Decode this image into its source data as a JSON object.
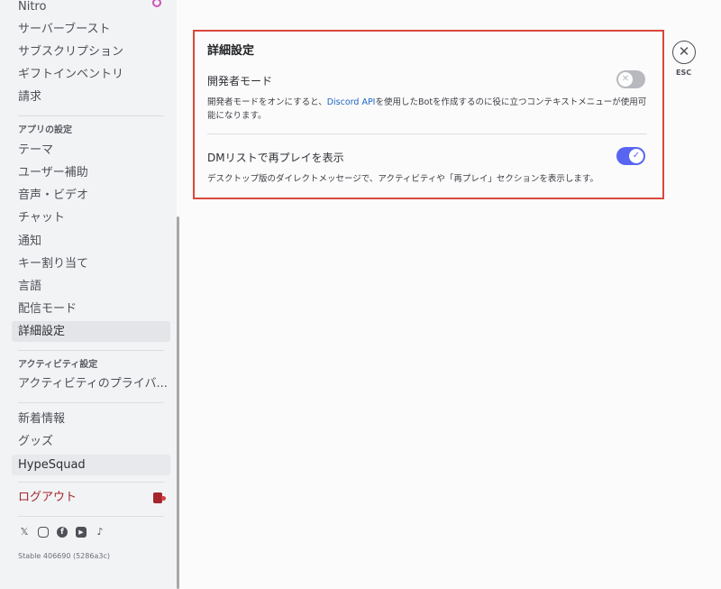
{
  "sidebar": {
    "nitro": "Nitro",
    "user_items": [
      "サーバーブースト",
      "サブスクリプション",
      "ギフトインベントリ",
      "請求"
    ],
    "app_section": "アプリの設定",
    "app_items": [
      "テーマ",
      "ユーザー補助",
      "音声・ビデオ",
      "チャット",
      "通知",
      "キー割り当て",
      "言語",
      "配信モード",
      "詳細設定"
    ],
    "activity_section": "アクティビティ設定",
    "activity_items": [
      "アクティビティのプライバ..."
    ],
    "misc_items": [
      "新着情報",
      "グッズ",
      "HypeSquad"
    ],
    "logout": "ログアウト",
    "social_icons": [
      "x-icon",
      "instagram-icon",
      "facebook-icon",
      "youtube-icon",
      "tiktok-icon"
    ],
    "version": "Stable 406690 (5286a3c)",
    "selected": "詳細設定"
  },
  "panel": {
    "title": "詳細設定",
    "dev_mode": {
      "label": "開発者モード",
      "desc_before": "開発者モードをオンにすると、",
      "link": "Discord API",
      "desc_after": "を使用したBotを作成するのに役に立つコンテキストメニューが使用可能になります。",
      "enabled": false
    },
    "dm_replay": {
      "label": "DMリストで再プレイを表示",
      "desc": "デスクトップ版のダイレクトメッセージで、アクティビティや「再プレイ」セクションを表示します。",
      "enabled": true
    }
  },
  "close": {
    "icon": "close-icon",
    "label": "ESC"
  },
  "colors": {
    "accent": "#5865f2",
    "highlight_border": "#d9473d",
    "danger": "#a4262c",
    "link": "#1e66c8"
  }
}
